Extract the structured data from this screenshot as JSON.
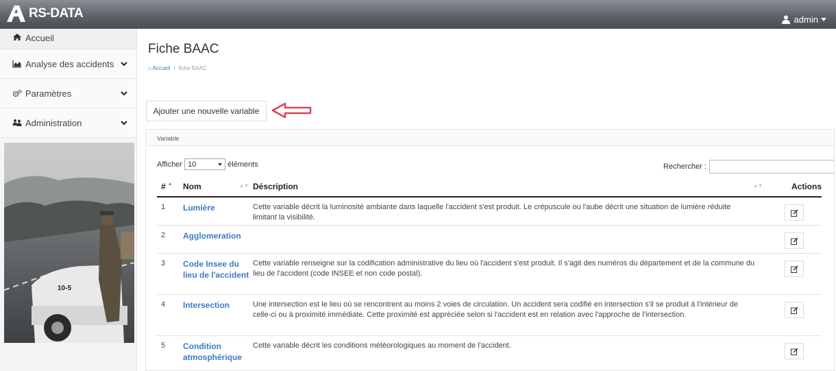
{
  "app": {
    "brand": "RS-DATA"
  },
  "header": {
    "user": "admin"
  },
  "sidebar": {
    "items": [
      {
        "label": "Accueil",
        "icon": "home-icon"
      },
      {
        "label": "Analyse des accidents",
        "icon": "chart-icon"
      },
      {
        "label": "Paramètres",
        "icon": "gears-icon"
      },
      {
        "label": "Administration",
        "icon": "users-icon"
      }
    ]
  },
  "main": {
    "title": "Fiche BAAC",
    "breadcrumb": {
      "home": "Accueil",
      "separator": "/",
      "current": "fiche BAAC"
    },
    "add_button": "Ajouter une nouvelle variable",
    "panel_title": "Variable",
    "length_prefix": "Afficher",
    "length_value": "10",
    "length_suffix": "éléments",
    "search_label": "Rechercher :",
    "search_value": "",
    "columns": {
      "num": "#",
      "nom": "Nom",
      "description": "Déscription",
      "actions": "Actions"
    },
    "rows": [
      {
        "num": "1",
        "nom": "Lumière",
        "description": "Cette variable décrit la luminosité ambiante dans laquelle l'accident s'est produit. Le crépuscule ou l'aube décrit une situation de lumière réduite limitant la visibilité."
      },
      {
        "num": "2",
        "nom": "Agglomeration",
        "description": ""
      },
      {
        "num": "3",
        "nom": "Code Insee du lieu de l'accident",
        "description": "Cette variable renseigne sur la codification administrative du lieu où l'accident s'est produit. Il s'agit des numéros du département et de la commune du lieu de l'accident (code INSEE et non code postal)."
      },
      {
        "num": "4",
        "nom": "Intersection",
        "description": "Une intersection est le lieu où se rencontrent au moins 2 voies de circulation. Un accident sera codifié en intersection s'il se produit à l'intérieur de celle-ci ou à proximité immédiate. Cette proximité est appréciée selon si l'accident est en relation avec l'approche de l'intersection."
      },
      {
        "num": "5",
        "nom": "Condition atmosphérique",
        "description": "Cette variable décrit les conditions météorologiques au moment de l'accident."
      }
    ]
  },
  "colors": {
    "navbar": "#5d6269",
    "link": "#3a7cc4",
    "arrow": "#e0405a"
  }
}
